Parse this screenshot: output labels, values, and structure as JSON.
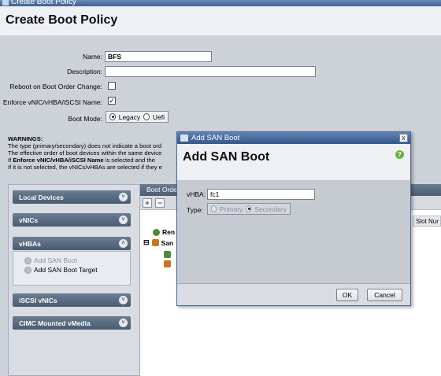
{
  "window": {
    "title": "Create Boot Policy"
  },
  "page": {
    "title": "Create Boot Policy"
  },
  "form": {
    "name_label": "Name:",
    "name_value": "BFS",
    "description_label": "Description:",
    "description_value": "",
    "reboot_label": "Reboot on Boot Order Change:",
    "reboot_checked": false,
    "enforce_label": "Enforce vNIC/vHBA/iSCSI Name:",
    "enforce_checked": true,
    "enforce_mark": "✓",
    "boot_mode_label": "Boot Mode:",
    "boot_mode_options": [
      "Legacy",
      "Uefi"
    ],
    "boot_mode_selected": "Legacy"
  },
  "warnings": {
    "title": "WARNINGS:",
    "line1": "The type (primary/secondary) does not indicate a boot ord",
    "line2": "The effective order of boot devices within the same device",
    "line3_prefix": "If ",
    "line3_bold": "Enforce vNIC/vHBA/iSCSI Name",
    "line3_suffix": " is selected and the",
    "line4": "If it is not selected, the vNICs/vHBAs are selected if they e"
  },
  "left_panel": {
    "sections": [
      {
        "label": "Local Devices",
        "chevron": "˅"
      },
      {
        "label": "vNICs",
        "chevron": "˅"
      },
      {
        "label": "vHBAs",
        "chevron": "˄"
      },
      {
        "label": "iSCSI vNICs",
        "chevron": "˅"
      },
      {
        "label": "CIMC Mounted vMedia",
        "chevron": "˅"
      }
    ],
    "vhba_items": [
      {
        "label": "Add SAN Boot",
        "enabled": false
      },
      {
        "label": "Add SAN Boot Target",
        "enabled": true
      }
    ]
  },
  "boot_order": {
    "header": "Boot Orde",
    "add_icon": "+",
    "remove_icon": "−",
    "column_slot": "Slot Nur",
    "tree": [
      {
        "label": "Ren",
        "icon": "remote-icon"
      },
      {
        "label": "San",
        "icon": "san-icon",
        "expander": "⊟"
      }
    ]
  },
  "dialog": {
    "titlebar": "Add SAN Boot",
    "close_glyph": "x",
    "heading": "Add SAN Boot",
    "help_glyph": "?",
    "vhba_label": "vHBA:",
    "vhba_value": "fc1",
    "type_label": "Type:",
    "type_options": [
      "Primary",
      "Secondary"
    ],
    "type_selected": "Secondary",
    "ok_label": "OK",
    "cancel_label": "Cancel"
  },
  "colors": {
    "titlebar": "#3e6196",
    "section_header": "#4a5c72",
    "help": "#6cb142"
  }
}
